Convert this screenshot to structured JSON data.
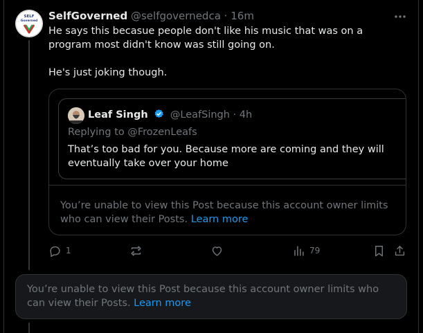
{
  "tweet": {
    "author_name": "SelfGoverned",
    "handle": "@selfgovernedca",
    "separator": "·",
    "time": "16m",
    "avatar_text_top": "SELF",
    "avatar_text_bottom": "Governed",
    "text_line1": "He says this becasue people don't like his music that was on a program most didn't know was still going on.",
    "text_line2": "He's just joking though."
  },
  "quote": {
    "screenshot": {
      "name": "Leaf Singh",
      "handle": "@LeafSingh",
      "separator": "·",
      "time": "4h",
      "replying_to": "Replying to @FrozenLeafs",
      "body": "That’s too bad for you. Because more are coming and they will eventually take over your home"
    },
    "notice_text": "You’re unable to view this Post because this account owner limits who can view their Posts.",
    "notice_link": "Learn more"
  },
  "actions": {
    "reply_count": "1",
    "retweet_count": "",
    "like_count": "",
    "views_count": "79"
  },
  "bottom_notice": {
    "text": "You’re unable to view this Post because this account owner limits who can view their Posts.",
    "link": "Learn more"
  },
  "colors": {
    "background": "#000000",
    "text_primary": "#e7e9ea",
    "text_secondary": "#71767b",
    "link": "#1d9bf0",
    "verified": "#1d9bf0",
    "border": "#2f3336"
  }
}
